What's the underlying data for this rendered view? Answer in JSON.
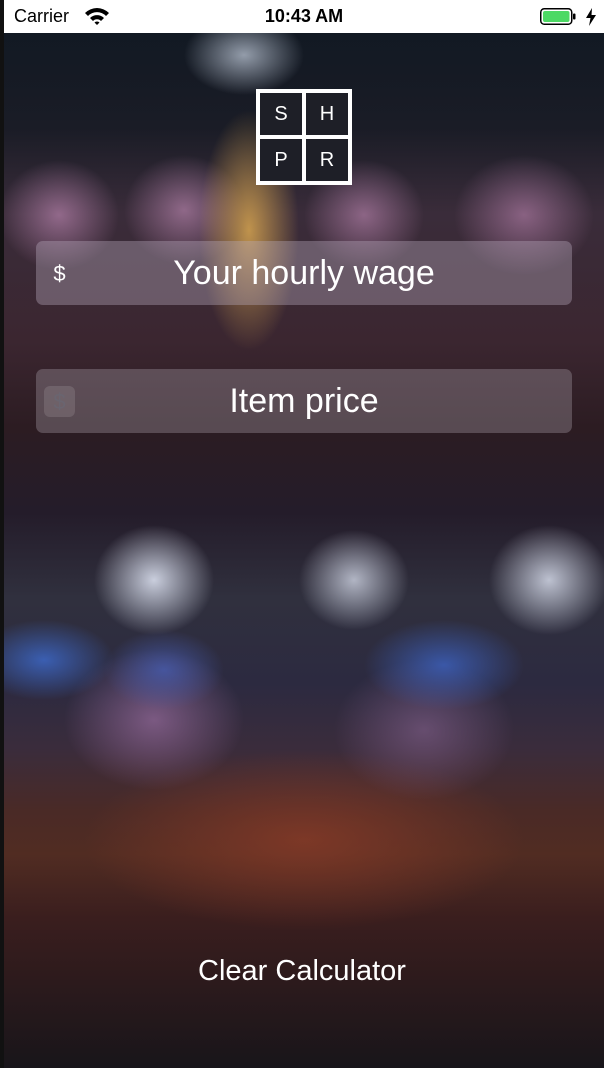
{
  "status_bar": {
    "carrier": "Carrier",
    "time": "10:43 AM",
    "wifi_icon": "wifi-icon",
    "battery_icon": "battery-icon",
    "charging_icon": "charging-bolt-icon"
  },
  "logo": {
    "letters": [
      "S",
      "H",
      "P",
      "R"
    ]
  },
  "fields": {
    "wage": {
      "currency_symbol": "$",
      "placeholder": "Your hourly wage",
      "value": ""
    },
    "price": {
      "currency_symbol": "$",
      "placeholder": "Item price",
      "value": ""
    }
  },
  "clear_button": {
    "label": "Clear Calculator"
  },
  "colors": {
    "status_bar_bg": "#ffffff",
    "battery_fill": "#4cd964",
    "text": "#ffffff"
  }
}
